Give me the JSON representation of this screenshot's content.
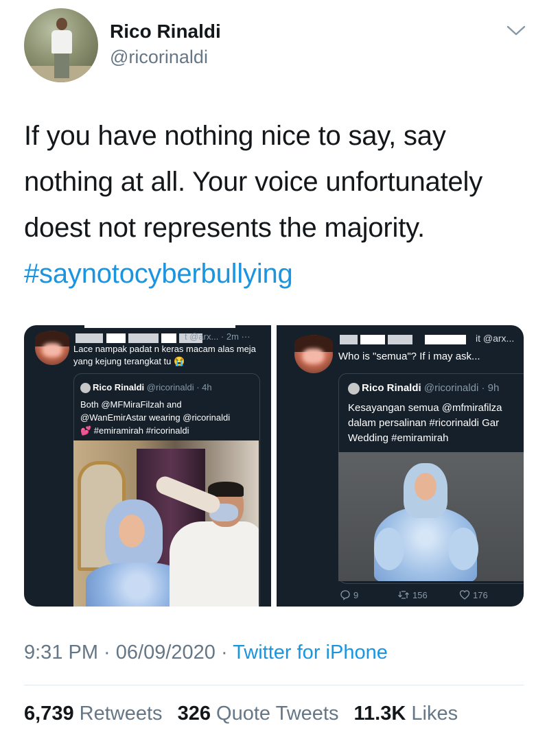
{
  "author": {
    "name": "Rico Rinaldi",
    "handle": "@ricorinaldi"
  },
  "tweet": {
    "text": "If you have nothing nice to say, say nothing at all. Your voice unfortunately doest not represents the majority. ",
    "hashtag": "#saynotocyberbullying"
  },
  "screenshot_left": {
    "reply_meta": "t @arx... · 2m ···",
    "reply_text": "Lace nampak padat n keras macam alas meja yang kejung terangkat tu 😭",
    "quote": {
      "author": "Rico Rinaldi",
      "handle_time": "@ricorinaldi · 4h",
      "text": "Both @MFMiraFilzah and\n@WanEmirAstar wearing @ricorinaldi\n💕 #emiramirah #ricorinaldi"
    }
  },
  "screenshot_right": {
    "reply_meta": "it @arx...",
    "reply_text": "Who is \"semua\"? If i may ask...",
    "quote": {
      "author": "Rico Rinaldi",
      "handle_time": "@ricorinaldi · 9h",
      "text": "Kesayangan semua @mfmirafilza\ndalam persalinan #ricorinaldi Gar\nWedding #emiramirah"
    },
    "actions": {
      "replies": "9",
      "retweets": "156",
      "likes": "176"
    }
  },
  "footer": {
    "timestamp": "9:31 PM · 06/09/2020 · ",
    "source": "Twitter for iPhone",
    "stats": {
      "retweets_count": "6,739",
      "retweets_label": "Retweets",
      "quotes_count": "326",
      "quotes_label": "Quote Tweets",
      "likes_count": "11.3K",
      "likes_label": "Likes"
    }
  },
  "colors": {
    "link": "#1b95e0",
    "secondary": "#657786",
    "dark_panel": "#15202b"
  }
}
